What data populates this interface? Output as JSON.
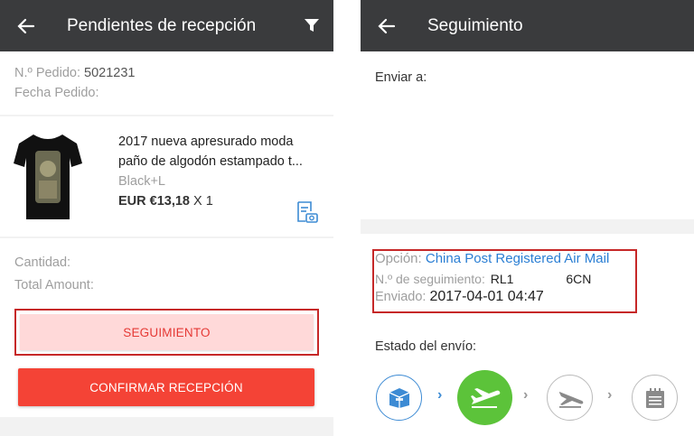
{
  "left": {
    "title": "Pendientes de recepción",
    "order_number_label": "N.º Pedido:",
    "order_number": "5021231",
    "order_date_label": "Fecha Pedido:",
    "product": {
      "name_line1": "2017 nueva apresurado moda",
      "name_line2": "paño de algodón estampado t...",
      "variant": "Black+L",
      "price": "EUR €13,18",
      "quantity": "X 1"
    },
    "quantity_label": "Cantidad:",
    "total_label": "Total Amount:",
    "tracking_button": "SEGUIMIENTO",
    "confirm_button": "CONFIRMAR RECEPCIÓN"
  },
  "right": {
    "title": "Seguimiento",
    "ship_to_label": "Enviar a:",
    "option_label": "Opción:",
    "option_value": "China Post Registered Air Mail",
    "tracking_label": "N.º de seguimiento:",
    "tracking_value_a": "RL1",
    "tracking_value_b": "6CN",
    "sent_label": "Enviado:",
    "sent_value": "2017-04-01 04:47",
    "status_label": "Estado del envío:",
    "steps": [
      "package-icon",
      "plane-takeoff-icon",
      "plane-landing-icon",
      "calendar-icon"
    ],
    "step_arrow": "›"
  },
  "colors": {
    "appbar": "#3a3b3d",
    "confirm": "#f44336",
    "tracking_bg": "#ffd9d9",
    "highlight_border": "#c62828",
    "link_blue": "#2b7fd4",
    "active_green": "#5cc33a"
  }
}
